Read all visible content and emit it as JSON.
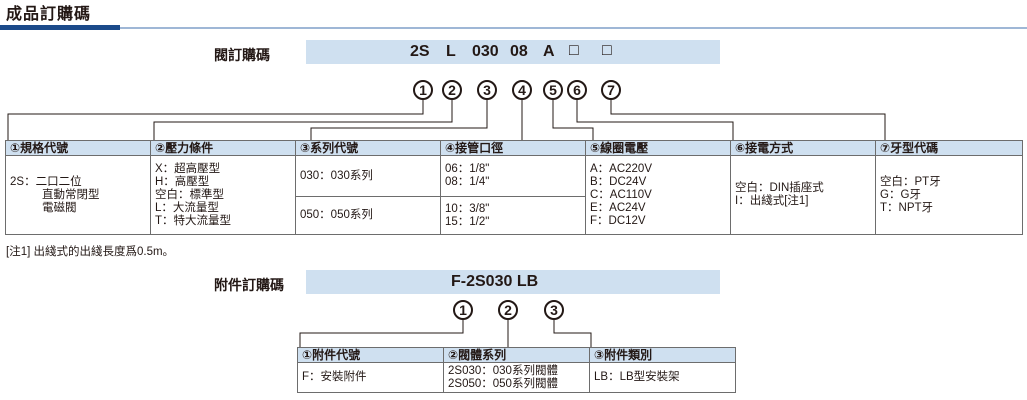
{
  "page_title": "成品訂購碼",
  "product_code": {
    "label": "閥訂購碼",
    "segments": [
      "2S",
      "L",
      "030",
      "08",
      "A",
      "□",
      "□"
    ],
    "markers": [
      "1",
      "2",
      "3",
      "4",
      "5",
      "6",
      "7"
    ]
  },
  "product_table": {
    "headers": [
      "①規格代號",
      "②壓力條件",
      "③系列代號",
      "④接管口徑",
      "⑤線圈電壓",
      "⑥接電方式",
      "⑦牙型代碼"
    ],
    "col1": [
      "2S：二口二位",
      "直動常閉型",
      "電磁閥"
    ],
    "col2": [
      "X：超高壓型",
      "H：高壓型",
      "空白：標準型",
      "L：大流量型",
      "T：特大流量型"
    ],
    "col3_row1": "030：030系列",
    "col3_row2": "050：050系列",
    "col4_row1": [
      "06：1/8\"",
      "08：1/4\""
    ],
    "col4_row2": [
      "10：3/8\"",
      "15：1/2\""
    ],
    "col5": [
      "A：AC220V",
      "B：DC24V",
      "C：AC110V",
      "E：AC24V",
      "F：DC12V"
    ],
    "col6": [
      "空白：DIN插座式",
      "I：出綫式[注1]"
    ],
    "col7": [
      "空白：PT牙",
      "G：G牙",
      "T：NPT牙"
    ]
  },
  "note": "[注1] 出綫式的出綫長度爲0.5m。",
  "accessory_code": {
    "label": "附件訂購碼",
    "code": "F-2S030 LB",
    "markers": [
      "1",
      "2",
      "3"
    ]
  },
  "accessory_table": {
    "headers": [
      "①附件代號",
      "②閥體系列",
      "③附件類別"
    ],
    "col1": "F：安裝附件",
    "col2": [
      "2S030：030系列閥體",
      "2S050：050系列閥體"
    ],
    "col3": "LB：LB型安裝架"
  },
  "colors": {
    "header_fill": "#cfe0f0",
    "accent": "#1b4a8a"
  }
}
